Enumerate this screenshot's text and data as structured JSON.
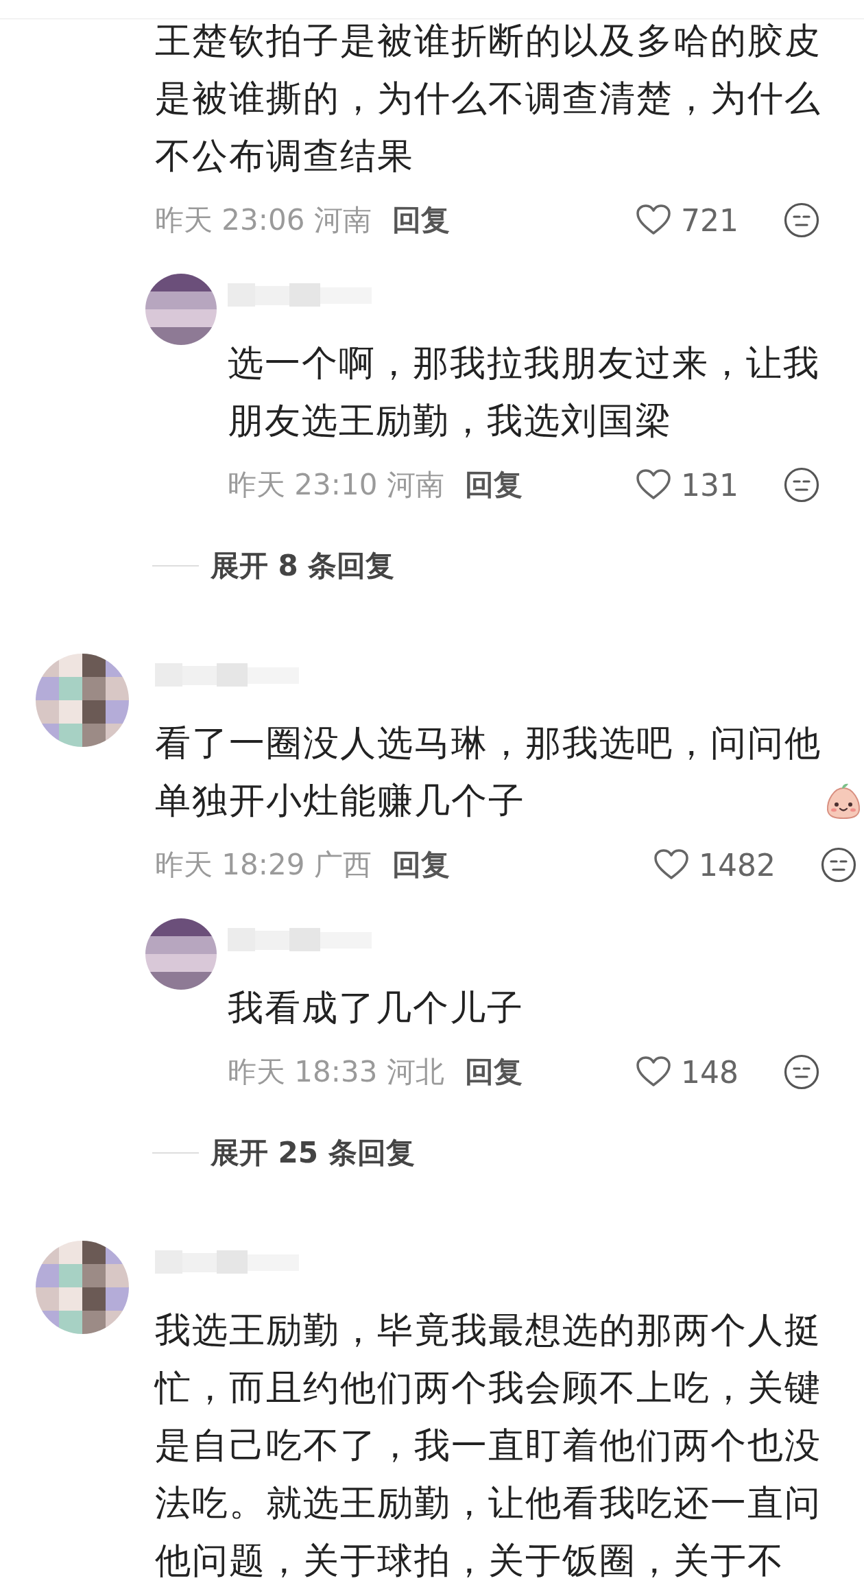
{
  "comments": [
    {
      "kind": "continued",
      "emoji": false,
      "text": "王楚钦拍子是被谁折断的以及多哈的胶皮是被谁撕的，为什么不调查清楚，为什么不公布调查结果",
      "time": "昨天 23:06",
      "location": "河南",
      "reply_label": "回复",
      "likes": "721",
      "replies": [
        {
          "text": "选一个啊，那我拉我朋友过来，让我朋友选王励勤，我选刘国梁",
          "time": "昨天 23:10",
          "location": "河南",
          "reply_label": "回复",
          "likes": "131"
        }
      ],
      "expand_label": "展开 8 条回复"
    },
    {
      "kind": "full",
      "emoji": true,
      "text": "看了一圈没人选马琳，那我选吧，问问他单独开小灶能赚几个子",
      "time": "昨天 18:29",
      "location": "广西",
      "reply_label": "回复",
      "likes": "1482",
      "replies": [
        {
          "text": "我看成了几个儿子",
          "time": "昨天 18:33",
          "location": "河北",
          "reply_label": "回复",
          "likes": "148"
        }
      ],
      "expand_label": "展开 25 条回复"
    },
    {
      "kind": "full",
      "emoji": false,
      "text": "我选王励勤，毕竟我最想选的那两个人挺忙，而且约他们两个我会顾不上吃，关键是自己吃不了，我一直盯着他们两个也没法吃。就选王励勤，让他看我吃还一直问他问题，关于球拍，关于饭圈，关于不"
    }
  ]
}
